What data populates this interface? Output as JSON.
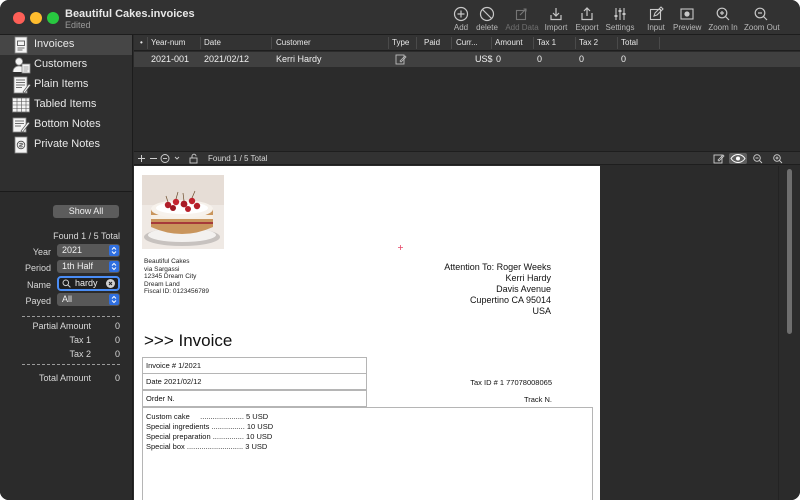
{
  "window": {
    "title": "Beautiful Cakes.invoices",
    "subtitle": "Edited"
  },
  "toolbar": {
    "add": "Add",
    "delete": "delete",
    "add_data": "Add Data",
    "import": "Import",
    "export": "Export",
    "settings": "Settings",
    "input": "Input",
    "preview": "Preview",
    "zoom_in": "Zoom In",
    "zoom_out": "Zoom Out"
  },
  "sidebar": {
    "items": [
      {
        "label": "Invoices",
        "icon": "invoice-icon"
      },
      {
        "label": "Customers",
        "icon": "customers-icon"
      },
      {
        "label": "Plain Items",
        "icon": "plain-items-icon"
      },
      {
        "label": "Tabled Items",
        "icon": "table-icon"
      },
      {
        "label": "Bottom Notes",
        "icon": "notes-icon"
      },
      {
        "label": "Private Notes",
        "icon": "private-notes-icon"
      }
    ],
    "selected_index": 0
  },
  "filters": {
    "show_all": "Show All",
    "found": "Found 1 / 5 Total",
    "year_label": "Year",
    "year_value": "2021",
    "period_label": "Period",
    "period_value": "1th Half",
    "name_label": "Name",
    "name_value": "hardy",
    "payed_label": "Payed",
    "payed_value": "All"
  },
  "summary": {
    "partial_amount_label": "Partial Amount",
    "partial_amount_value": "0",
    "tax1_label": "Tax 1",
    "tax1_value": "0",
    "tax2_label": "Tax 2",
    "tax2_value": "0",
    "total_amount_label": "Total Amount",
    "total_amount_value": "0"
  },
  "table": {
    "sort_indicator": "•",
    "columns": [
      "Year-num",
      "Date",
      "Customer",
      "Type",
      "Paid",
      "Curr...",
      "Amount",
      "Tax 1",
      "Tax 2",
      "Total"
    ],
    "rows": [
      {
        "year_num": "2021-001",
        "date": "2021/02/12",
        "customer": "Kerri Hardy",
        "paid": "",
        "currency": "US$",
        "amount": "0",
        "tax1": "0",
        "tax2": "0",
        "total": "0"
      }
    ]
  },
  "bottom_bar": {
    "found": "Found 1 / 5 Total"
  },
  "invoice": {
    "from": [
      "Beautiful Cakes",
      "via Sargassi",
      "12345 Dream City",
      "Dream Land",
      "Fiscal ID: 0123456789"
    ],
    "to": [
      "Attention To: Roger Weeks",
      "Kerri Hardy",
      "Davis Avenue",
      "Cupertino CA 95014",
      "USA"
    ],
    "heading": ">>> Invoice",
    "number": "Invoice # 1/2021",
    "date": "Date 2021/02/12",
    "order": "Order N.",
    "tax_id": "Tax ID # 1 77078008065",
    "track": "Track N.",
    "items": [
      "Custom cake     ..................... 5 USD",
      "Special ingredients ................ 10 USD",
      "Special preparation ............... 10 USD",
      "Special box ........................... 3 USD"
    ]
  },
  "colors": {
    "accent": "#2f6fe0",
    "focus_ring": "#4a8df6",
    "selection_row": "#404040"
  }
}
